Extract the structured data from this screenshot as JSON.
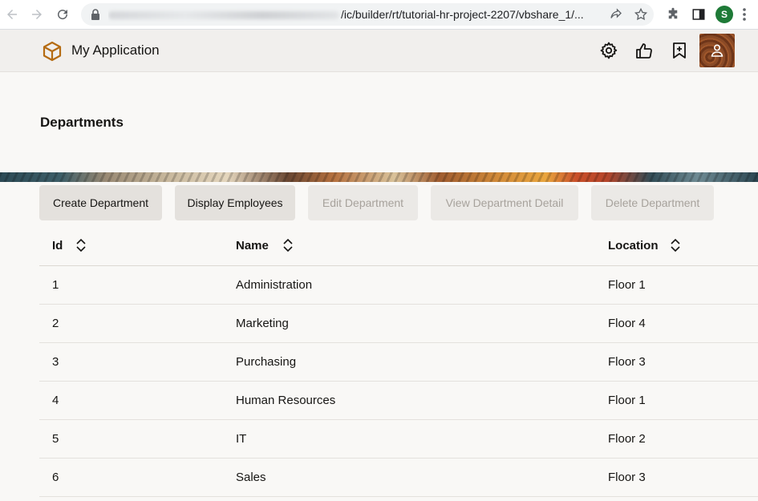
{
  "browser": {
    "url_visible": "/ic/builder/rt/tutorial-hr-project-2207/vbshare_1/...",
    "profile_initial": "S",
    "colors": {
      "profile": "#1e7a37"
    }
  },
  "app": {
    "title": "My Application",
    "icons": [
      "cube-logo-icon",
      "gear-icon",
      "thumbs-up-icon",
      "bookmark-add-icon",
      "user-icon"
    ]
  },
  "page": {
    "title": "Departments"
  },
  "toolbar": {
    "buttons": [
      {
        "label": "Create Department",
        "enabled": true
      },
      {
        "label": "Display Employees",
        "enabled": true
      },
      {
        "label": "Edit Department",
        "enabled": false
      },
      {
        "label": "View Department Detail",
        "enabled": false
      },
      {
        "label": "Delete Department",
        "enabled": false
      }
    ]
  },
  "table": {
    "columns": [
      "Id",
      "Name",
      "Location"
    ],
    "rows": [
      {
        "id": "1",
        "name": "Administration",
        "location": "Floor 1"
      },
      {
        "id": "2",
        "name": "Marketing",
        "location": "Floor 4"
      },
      {
        "id": "3",
        "name": "Purchasing",
        "location": "Floor 3"
      },
      {
        "id": "4",
        "name": "Human Resources",
        "location": "Floor 1"
      },
      {
        "id": "5",
        "name": "IT",
        "location": "Floor 2"
      },
      {
        "id": "6",
        "name": "Sales",
        "location": "Floor 3"
      }
    ]
  }
}
